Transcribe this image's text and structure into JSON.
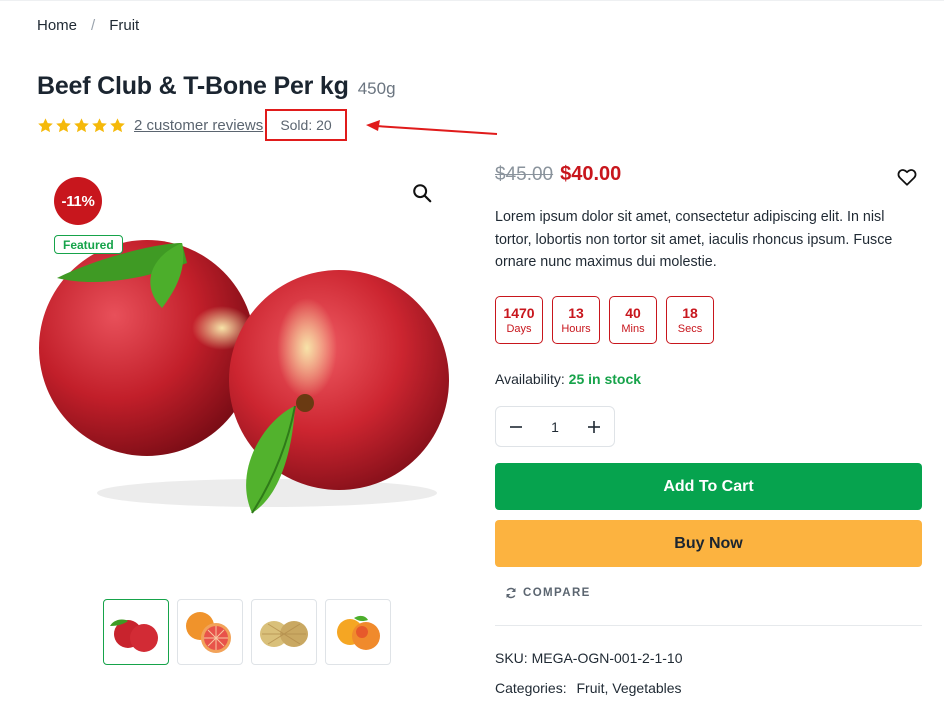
{
  "breadcrumb": {
    "home": "Home",
    "separator": "/",
    "current": "Fruit"
  },
  "product": {
    "title": "Beef Club & T-Bone Per kg",
    "weight": "450g",
    "rating_stars": 5,
    "reviews": "2 customer reviews",
    "sold": "Sold: 20",
    "discount_badge": "-11%",
    "featured_badge": "Featured",
    "old_price": "$45.00",
    "new_price": "$40.00",
    "description": "Lorem ipsum dolor sit amet, consectetur adipiscing elit. In nisl tortor, lobortis non tortor sit amet, iaculis rhoncus ipsum. Fusce ornare nunc maximus dui molestie.",
    "availability_label": "Availability:",
    "stock": "25 in stock",
    "quantity": "1",
    "add_to_cart": "Add To Cart",
    "buy_now": "Buy Now",
    "compare": "COMPARE",
    "sku": "SKU: MEGA-OGN-001-2-1-10",
    "categories_label": "Categories:",
    "categories": "Fruit, Vegetables"
  },
  "countdown": [
    {
      "value": "1470",
      "label": "Days"
    },
    {
      "value": "13",
      "label": "Hours"
    },
    {
      "value": "40",
      "label": "Mins"
    },
    {
      "value": "18",
      "label": "Secs"
    }
  ],
  "thumbnails": [
    "nectarines",
    "grapefruit",
    "melons",
    "peaches"
  ],
  "colors": {
    "accent_red": "#c8161d",
    "green": "#06a34e",
    "orange": "#fcb340",
    "annotation": "#e01b1b"
  }
}
